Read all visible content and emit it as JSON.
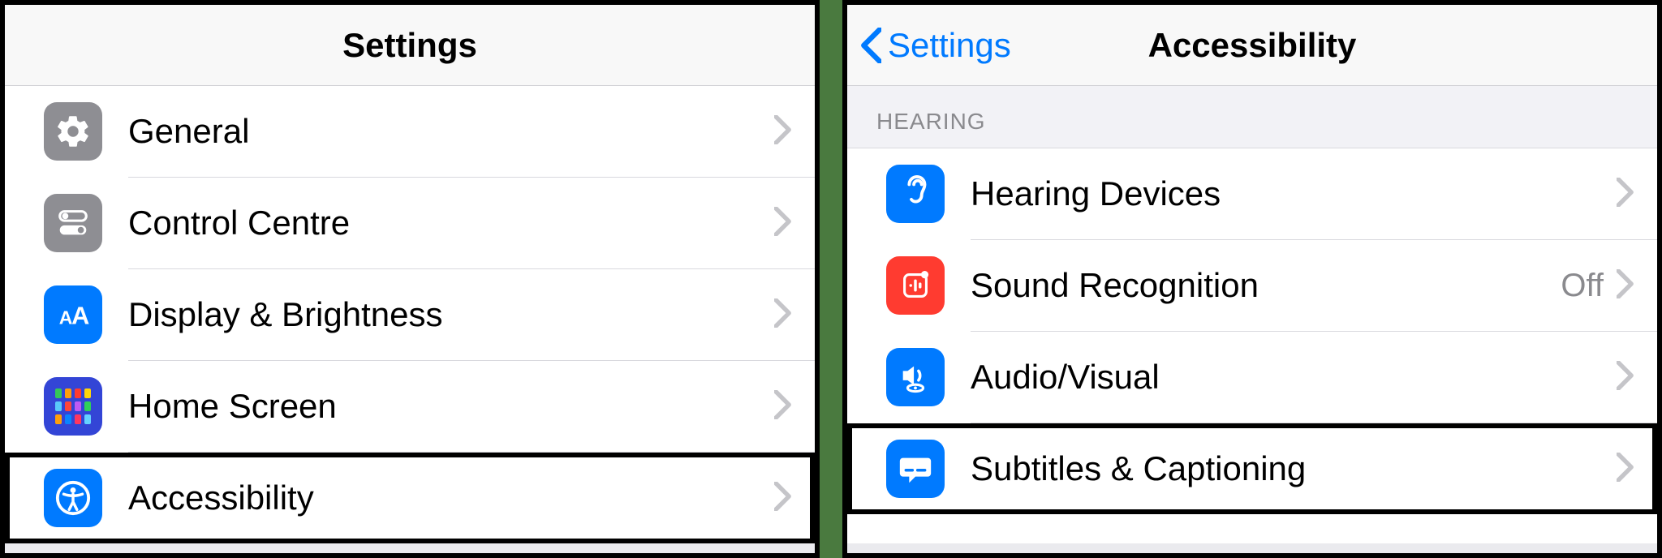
{
  "left": {
    "title": "Settings",
    "rows": [
      {
        "label": "General"
      },
      {
        "label": "Control Centre"
      },
      {
        "label": "Display & Brightness"
      },
      {
        "label": "Home Screen"
      },
      {
        "label": "Accessibility"
      }
    ]
  },
  "right": {
    "back": "Settings",
    "title": "Accessibility",
    "section_header": "HEARING",
    "rows": [
      {
        "label": "Hearing Devices",
        "detail": ""
      },
      {
        "label": "Sound Recognition",
        "detail": "Off"
      },
      {
        "label": "Audio/Visual",
        "detail": ""
      },
      {
        "label": "Subtitles & Captioning",
        "detail": ""
      }
    ]
  }
}
